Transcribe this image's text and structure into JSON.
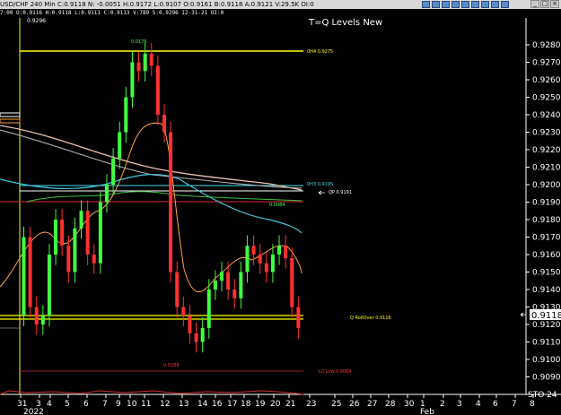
{
  "window": {
    "title": "USD/CHF 240 Min",
    "ohlc_line": "USD/CHF 240 Min  C:0.9118  N: -0.0051  H:0.9172  L:0.9107  O:0.9161  B:0.9118  A:0.9121  V:29.5K  OI:0",
    "info_line": "7:00  O:0.9116  H:0.9118  L:0.9111  C:0.9113  V:789  S:0.9296  12-31-21  OI:0",
    "corner_price": "0.9296",
    "toolbar_icons": [
      "cursor-icon",
      "crosshair-icon",
      "draw-icon",
      "zoom-in-icon",
      "zoom-out-icon",
      "bar-style-icon",
      "line-style-icon",
      "text-icon",
      "settings-icon",
      "print-icon",
      "grid-icon",
      "close-icon"
    ],
    "window_buttons": [
      "_",
      "□",
      "×"
    ]
  },
  "chart_title": "T=Q Levels New",
  "price_axis": {
    "labels": [
      "0.9280",
      "0.9270",
      "0.9260",
      "0.9250",
      "0.9240",
      "0.9230",
      "0.9220",
      "0.9210",
      "0.9200",
      "0.9190",
      "0.9180",
      "0.9170",
      "0.9160",
      "0.9150",
      "0.9140",
      "0.9130",
      "0.9120",
      "0.9110",
      "0.9100",
      "0.9090"
    ],
    "current_price": "0.9118",
    "current_price_color": "#ffffff"
  },
  "date_axis": {
    "labels": [
      "31",
      "3",
      "4",
      "5",
      "6",
      "7",
      "9",
      "10",
      "11",
      "12",
      "13",
      "14",
      "16",
      "17",
      "18",
      "19",
      "20",
      "21",
      "23",
      "25",
      "26",
      "27",
      "28",
      "30",
      "1",
      "2",
      "3",
      "4",
      "6",
      "7",
      "8"
    ],
    "sub_labels": [
      "2022",
      "Feb"
    ]
  },
  "levels": [
    {
      "label": "0H4  0.9275",
      "color": "#ffff00"
    },
    {
      "label": "0H3  0.9195",
      "color": "#40e0f0"
    },
    {
      "label": "QP  0.9191",
      "color": "#ffffff"
    },
    {
      "label": "Q RollOver  0.9116",
      "color": "#ffff00"
    },
    {
      "label": "L0 Low  0.9084",
      "color": "#ff3030"
    }
  ],
  "annotations": [
    {
      "text": "0.0176",
      "color": "#50ff50"
    },
    {
      "text": "0.0084",
      "color": "#50ff50"
    },
    {
      "text": "0.0188",
      "color": "#ff3030"
    }
  ],
  "indicator_label": "STO 24",
  "chart_data": {
    "type": "candlestick",
    "title": "T=Q Levels New",
    "symbol": "USD/CHF 240 Min",
    "ylim": [
      0.908,
      0.929
    ],
    "series": [
      {
        "name": "price",
        "values": [
          0.917,
          0.913,
          0.912,
          0.9125,
          0.916,
          0.918,
          0.9165,
          0.915,
          0.9175,
          0.9185,
          0.916,
          0.9155,
          0.919,
          0.92,
          0.9215,
          0.923,
          0.925,
          0.927,
          0.9265,
          0.9275,
          0.9268,
          0.924,
          0.923,
          0.915,
          0.913,
          0.9125,
          0.9115,
          0.911,
          0.9118,
          0.914,
          0.9145,
          0.915,
          0.914,
          0.9135,
          0.915,
          0.9165,
          0.916,
          0.9155,
          0.915,
          0.916,
          0.9165,
          0.9158,
          0.913,
          0.9118
        ]
      },
      {
        "name": "ma-orange",
        "values": [
          0.913,
          0.9135,
          0.914,
          0.9145,
          0.915,
          0.916,
          0.9175,
          0.9185,
          0.9195,
          0.9205,
          0.9212,
          0.92,
          0.918,
          0.916,
          0.9145,
          0.9138,
          0.914,
          0.9145,
          0.915,
          0.9148,
          0.915,
          0.9155,
          0.9145
        ]
      },
      {
        "name": "ma-cyan",
        "values": [
          0.92,
          0.9195,
          0.919,
          0.9185,
          0.9183,
          0.9185,
          0.919,
          0.9197,
          0.92,
          0.9195,
          0.9188,
          0.9182,
          0.9178,
          0.9176,
          0.9174,
          0.9172,
          0.917,
          0.9168
        ]
      }
    ]
  }
}
